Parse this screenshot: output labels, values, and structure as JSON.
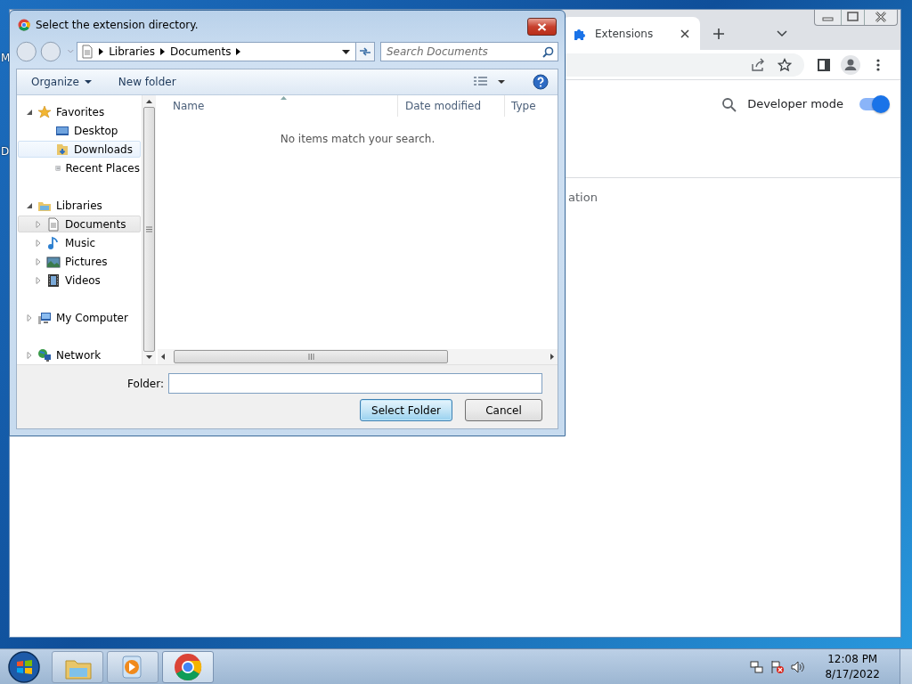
{
  "desktop": {
    "icon_labels": [
      "M",
      "D"
    ]
  },
  "browser": {
    "tabs": [
      {
        "label": "Extensions",
        "selected": true
      }
    ],
    "developer_mode": {
      "label": "Developer mode",
      "on": true
    },
    "partial_text": "ation"
  },
  "dialog": {
    "title": "Select the extension directory.",
    "breadcrumb": [
      "Libraries",
      "Documents"
    ],
    "search": {
      "placeholder": "Search Documents"
    },
    "toolbar": [
      "Organize",
      "New folder"
    ],
    "nav": [
      {
        "label": "Favorites",
        "expanded": true,
        "selected": false,
        "hovered": false,
        "children": [
          {
            "label": "Desktop",
            "selected": false,
            "hovered": false
          },
          {
            "label": "Downloads",
            "selected": false,
            "hovered": true
          },
          {
            "label": "Recent Places",
            "selected": false,
            "hovered": false
          }
        ]
      },
      {
        "label": "Libraries",
        "expanded": true,
        "selected": false,
        "hovered": false,
        "children": [
          {
            "label": "Documents",
            "expanded": false,
            "selected": true,
            "hovered": false
          },
          {
            "label": "Music",
            "expanded": false,
            "selected": false,
            "hovered": false
          },
          {
            "label": "Pictures",
            "expanded": false,
            "selected": false,
            "hovered": false
          },
          {
            "label": "Videos",
            "expanded": false,
            "selected": false,
            "hovered": false
          }
        ]
      },
      {
        "label": "My Computer",
        "expanded": false,
        "selected": false,
        "hovered": false
      },
      {
        "label": "Network",
        "expanded": false,
        "selected": false,
        "hovered": false
      }
    ],
    "columns": [
      "Name",
      "Date modified",
      "Type"
    ],
    "empty_message": "No items match your search.",
    "folder_field": {
      "label": "Folder:"
    },
    "buttons": [
      {
        "label": "Select Folder",
        "default": true
      },
      {
        "label": "Cancel",
        "default": false
      }
    ]
  },
  "taskbar": {
    "apps": [
      {
        "selected": false
      },
      {
        "selected": false
      },
      {
        "selected": true
      }
    ],
    "time": "12:08 PM",
    "date": "8/17/2022"
  }
}
